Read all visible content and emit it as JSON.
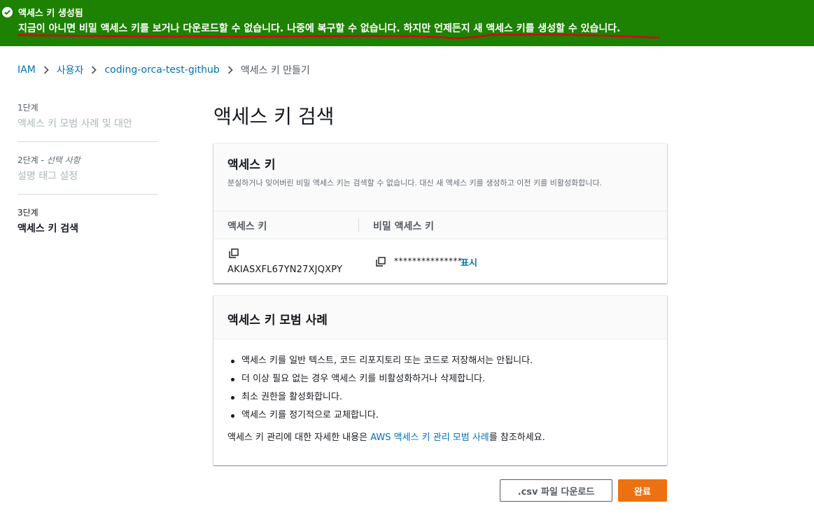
{
  "flash": {
    "title": "액세스 키 생성됨",
    "message": "지금이 아니면 비밀 액세스 키를 보거나 다운로드할 수 없습니다. 나중에 복구할 수 없습니다. 하지만 언제든지 새 액세스 키를 생성할 수 있습니다.",
    "icon": "check-circle-icon",
    "colors": {
      "background": "#1d8102",
      "annotation_underline": "#e0001b"
    }
  },
  "breadcrumb": {
    "items": [
      "IAM",
      "사용자",
      "coding-orca-test-github"
    ],
    "current": "액세스 키 만들기"
  },
  "steps": [
    {
      "number": "1단계",
      "optional": "",
      "name": "액세스 키 모범 사례 및 대안"
    },
    {
      "number": "2단계",
      "optional": "선택 사항",
      "name": "설명 태그 설정"
    },
    {
      "number": "3단계",
      "optional": "",
      "name": "액세스 키 검색"
    }
  ],
  "page_title": "액세스 키 검색",
  "keys_panel": {
    "title": "액세스 키",
    "description": "분실하거나 잊어버린 비밀 액세스 키는 검색할 수 없습니다. 대신 새 액세스 키를 생성하고 이전 키를 비활성화합니다.",
    "columns": [
      "액세스 키",
      "비밀 액세스 키"
    ],
    "access_key_id": "AKIASXFL67YN27XJQXPY",
    "secret_masked": "***************",
    "show_label": "표시"
  },
  "best_panel": {
    "title": "액세스 키 모범 사례",
    "items": [
      "액세스 키를 일반 텍스트, 코드 리포지토리 또는 코드로 저장해서는 안됩니다.",
      "더 이상 필요 없는 경우 액세스 키를 비활성화하거나 삭제합니다.",
      "최소 권한을 활성화합니다.",
      "액세스 키를 정기적으로 교체합니다."
    ],
    "ref_before": "액세스 키 관리에 대한 자세한 내용은 ",
    "ref_link": "AWS 액세스 키 관리 모범 사례",
    "ref_after": "를 참조하세요."
  },
  "buttons": {
    "download_csv": ".csv 파일 다운로드",
    "done": "완료"
  },
  "colors": {
    "link": "#0073bb",
    "primary_button": "#ec7211"
  }
}
